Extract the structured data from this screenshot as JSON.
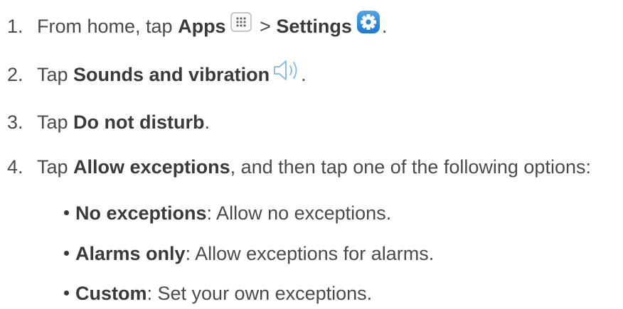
{
  "steps": [
    {
      "number": "1.",
      "text_a": "From home, tap ",
      "bold_a": "Apps",
      "icon_a": "apps-grid-icon",
      "text_b": " > ",
      "bold_b": "Settings",
      "icon_b": "settings-gear-icon",
      "text_c": "."
    },
    {
      "number": "2.",
      "text_a": "Tap ",
      "bold_a": "Sounds and vibration",
      "icon_a": "speaker-icon",
      "text_b": "."
    },
    {
      "number": "3.",
      "text_a": "Tap ",
      "bold_a": "Do not disturb",
      "text_b": "."
    },
    {
      "number": "4.",
      "text_a": "Tap ",
      "bold_a": "Allow exceptions",
      "text_b": ", and then tap one of the following options:"
    }
  ],
  "options": [
    {
      "bold": "No exceptions",
      "text": ": Allow no exceptions."
    },
    {
      "bold": "Alarms only",
      "text": ": Allow exceptions for alarms."
    },
    {
      "bold": "Custom",
      "text": ": Set your own exceptions."
    }
  ],
  "colors": {
    "text": "#4a4a4a",
    "settings_icon": "#2f8fe6",
    "speaker_icon": "#8fbde8",
    "apps_icon_border": "#b8b8b8"
  }
}
